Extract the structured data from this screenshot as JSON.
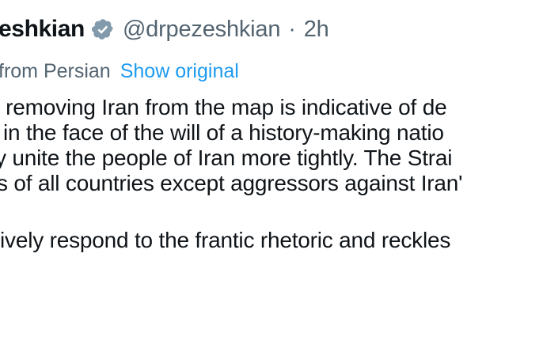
{
  "header": {
    "display_name": "eshkian",
    "handle": "@drpezeshkian",
    "separator": "·",
    "timestamp": "2h",
    "verified_color": "#829aab"
  },
  "translation": {
    "translated_label": "from Persian",
    "show_original_label": "Show original",
    "link_color": "#1d9bf0"
  },
  "tweet": {
    "lines": [
      "f removing Iran from the map is indicative of de",
      "in the face of the will of a history-making natio",
      "y unite the people of Iran more tightly. The Strai",
      "s of all countries except aggressors against Iran'",
      "ively respond to the frantic rhetoric and reckles"
    ]
  }
}
